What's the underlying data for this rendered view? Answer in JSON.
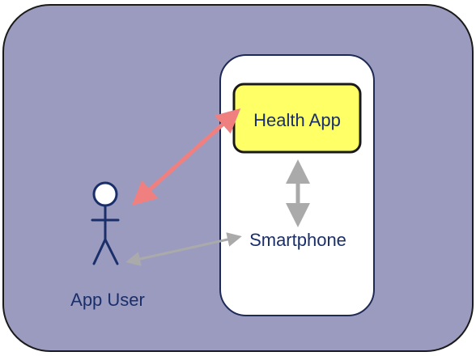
{
  "diagram": {
    "app_box_label": "Health App",
    "device_label": "Smartphone",
    "actor_label": "App User"
  },
  "colors": {
    "outer_fill": "#9b9bc0",
    "outer_stroke": "#1a1a1a",
    "phone_fill": "#ffffff",
    "phone_stroke": "#1e2a55",
    "app_fill": "#ffff66",
    "app_stroke": "#1a1a1a",
    "text_color": "#1a2f6a",
    "actor_stroke": "#1a2f6a",
    "arrow_pink": "#f08080",
    "arrow_gray": "#aaaaaa"
  }
}
